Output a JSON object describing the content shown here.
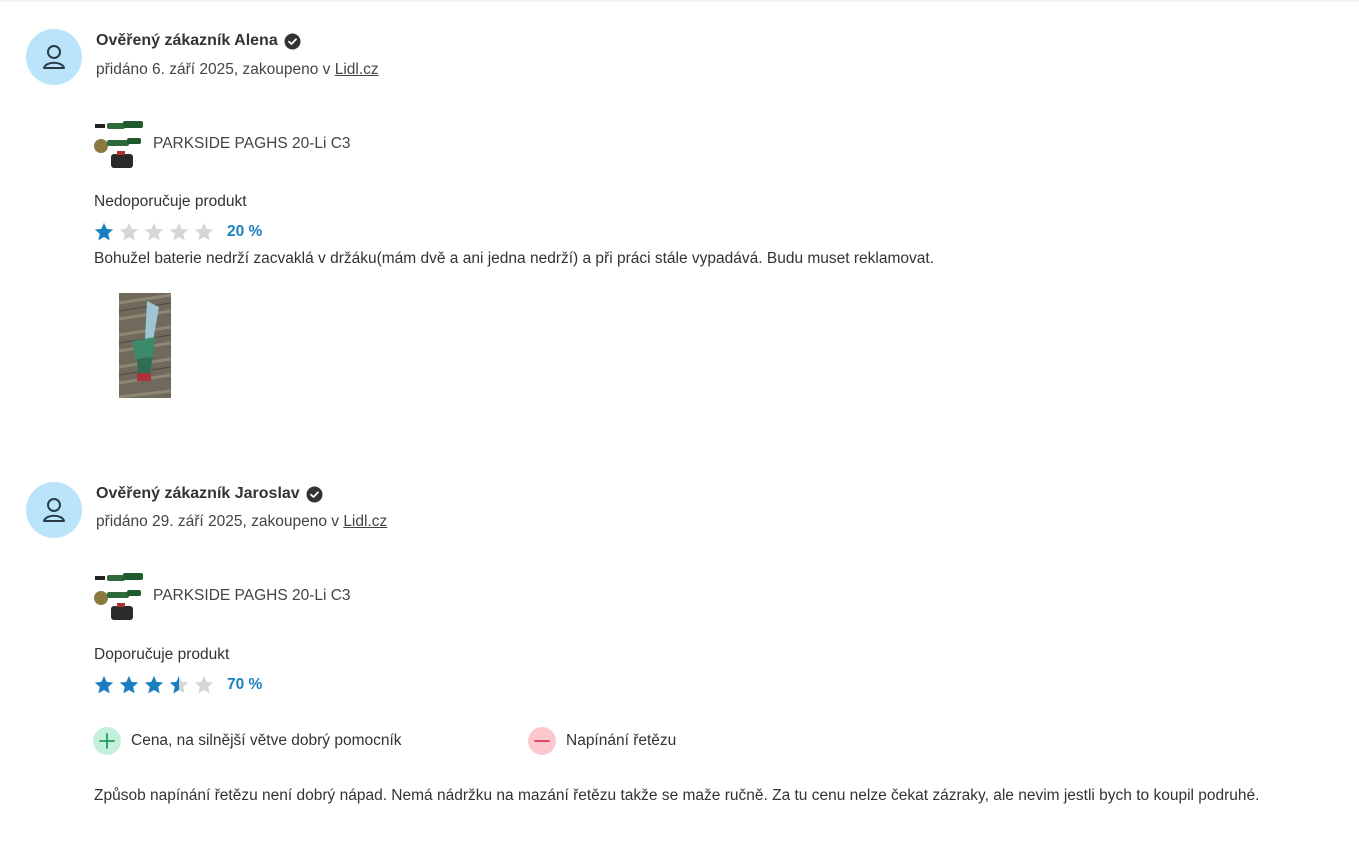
{
  "reviews": [
    {
      "author": "Ověřený zákazník Alena",
      "meta_prefix": "přidáno 6. září 2025, zakoupeno v ",
      "shop": "Lidl.cz",
      "product": "PARKSIDE PAGHS 20-Li C3",
      "recommendation": "Nedoporučuje produkt",
      "rating_percent": "20 %",
      "stars_value": 1,
      "text": "Bohužel baterie nedrží zacvaklá v držáku(mám dvě a ani jedna nedrží) a při práci stále vypadává. Budu muset reklamovat."
    },
    {
      "author": "Ověřený zákazník Jaroslav",
      "meta_prefix": "přidáno 29. září 2025, zakoupeno v ",
      "shop": "Lidl.cz",
      "product": "PARKSIDE PAGHS 20-Li C3",
      "recommendation": "Doporučuje produkt",
      "rating_percent": "70 %",
      "stars_value": 3.5,
      "pros": [
        "Cena, na silnější větve dobrý pomocník"
      ],
      "cons": [
        "Napínání řetězu"
      ],
      "text": "Způsob napínání řetězu není dobrý nápad. Nemá nádržku na mazání řetězu takže se maže ručně. Za tu cenu nelze čekat zázraky, ale nevim jestli bych to koupil podruhé."
    }
  ],
  "colors": {
    "star_filled": "#1a7fc1",
    "star_empty": "#d6d6d6",
    "avatar_bg": "#b9e4f9",
    "pro_bg": "#c5f0dc",
    "con_bg": "#fbc8cf"
  }
}
